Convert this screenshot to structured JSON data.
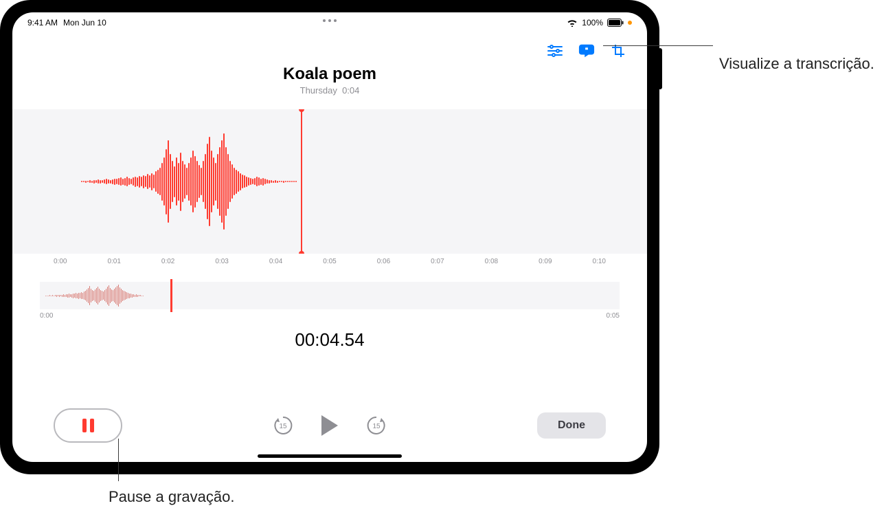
{
  "statusbar": {
    "time": "9:41 AM",
    "date": "Mon Jun 10",
    "battery_text": "100%"
  },
  "header": {
    "title": "Koala poem",
    "day": "Thursday",
    "length": "0:04"
  },
  "ruler": [
    "0:00",
    "0:01",
    "0:02",
    "0:03",
    "0:04",
    "0:05",
    "0:06",
    "0:07",
    "0:08",
    "0:09",
    "0:10"
  ],
  "overview": {
    "start": "0:00",
    "end": "0:05"
  },
  "timer": "00:04.54",
  "controls": {
    "skip_back_seconds": "15",
    "skip_fwd_seconds": "15",
    "done_label": "Done"
  },
  "callouts": {
    "transcript": "Visualize a transcrição.",
    "pause": "Pause a gravação."
  },
  "icons": {
    "options": "options-icon",
    "transcript": "transcript-icon",
    "trim": "trim-icon"
  }
}
